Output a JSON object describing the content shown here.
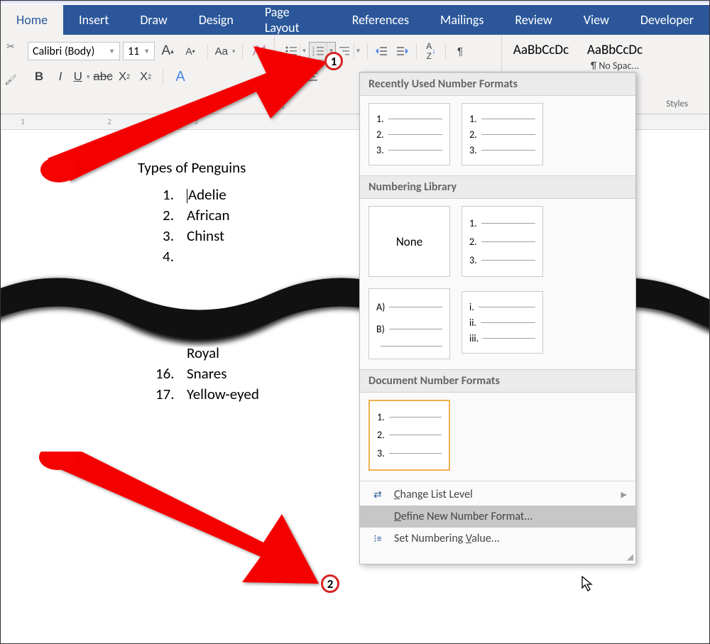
{
  "tabs": [
    "Home",
    "Insert",
    "Draw",
    "Design",
    "Page Layout",
    "References",
    "Mailings",
    "Review",
    "View",
    "Developer"
  ],
  "active_tab_index": 0,
  "font": {
    "name": "Calibri (Body)",
    "size": "11"
  },
  "styles": {
    "samples": [
      "AaBbCcDc",
      "AaBbCcDc"
    ],
    "captions": [
      "",
      "¶ No Spac..."
    ],
    "group_label": "Styles"
  },
  "ruler": [
    "1",
    "2",
    "3"
  ],
  "document": {
    "title": "Types of Penguins",
    "items_top": [
      {
        "n": "1.",
        "t": "Adelie"
      },
      {
        "n": "2.",
        "t": "African"
      },
      {
        "n": "3.",
        "t": "Chinst"
      },
      {
        "n": "4.",
        "t": ""
      }
    ],
    "items_bottom": [
      {
        "n": "",
        "t": "Royal"
      },
      {
        "n": "16.",
        "t": "Snares"
      },
      {
        "n": "17.",
        "t": "Yellow-eyed"
      }
    ]
  },
  "panel": {
    "sections": {
      "recent": "Recently Used Number Formats",
      "library": "Numbering Library",
      "document": "Document Number Formats"
    },
    "none_label": "None",
    "presets": {
      "numeric": [
        "1.",
        "2.",
        "3."
      ],
      "alpha": [
        "A)",
        "B)",
        ""
      ],
      "roman": [
        "i.",
        "ii.",
        "iii."
      ]
    },
    "menu": {
      "change_level": "Change List Level",
      "define_format": "Define New Number Format...",
      "set_value": "Set Numbering Value..."
    }
  },
  "callouts": {
    "c1": "1",
    "c2": "2"
  }
}
